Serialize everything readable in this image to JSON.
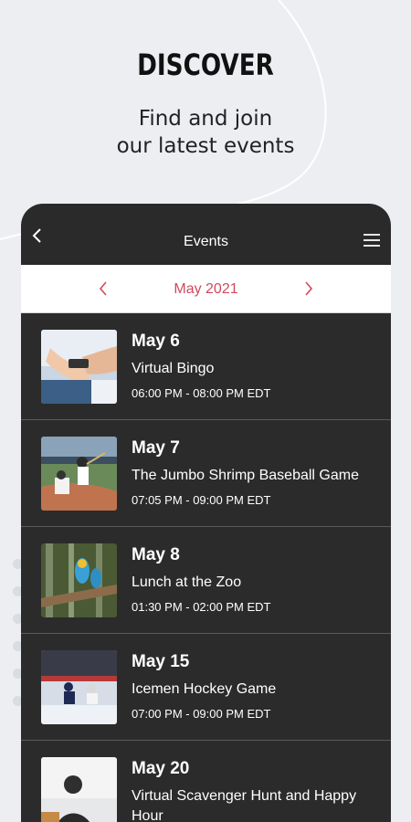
{
  "hero": {
    "headline": "DISCOVER",
    "subtitle_line1": "Find and join",
    "subtitle_line2": "our latest events"
  },
  "app": {
    "title": "Events",
    "back_icon": "chevron-left-icon",
    "menu_icon": "hamburger-menu-icon"
  },
  "month_nav": {
    "label": "May 2021",
    "accent_color": "#d1485e"
  },
  "events": [
    {
      "date": "May 6",
      "title": "Virtual Bingo",
      "time": "06:00 PM - 08:00 PM EDT"
    },
    {
      "date": "May 7",
      "title": "The Jumbo Shrimp Baseball Game",
      "time": "07:05 PM - 09:00 PM EDT"
    },
    {
      "date": "May 8",
      "title": "Lunch at the Zoo",
      "time": "01:30 PM - 02:00 PM EDT"
    },
    {
      "date": "May 15",
      "title": "Icemen Hockey Game",
      "time": "07:00 PM - 09:00 PM EDT"
    },
    {
      "date": "May 20",
      "title": "Virtual Scavenger Hunt and Happy Hour",
      "time": ""
    }
  ]
}
